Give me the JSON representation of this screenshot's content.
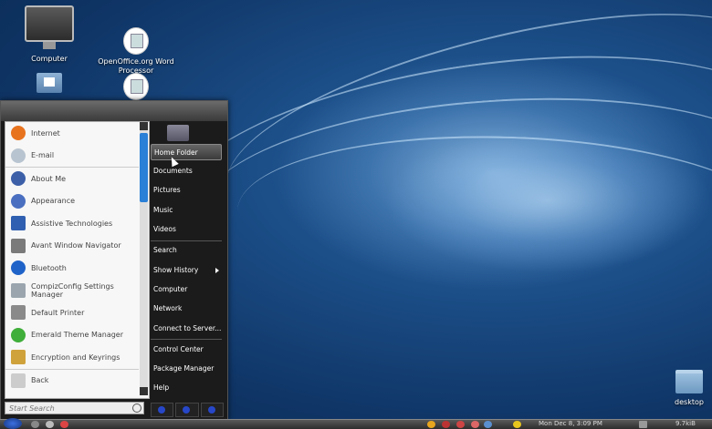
{
  "desktop": {
    "icons": [
      {
        "label": "Computer"
      },
      {
        "label": "OpenOffice.org Word Processor"
      },
      {
        "label": ""
      },
      {
        "label": ""
      },
      {
        "label": "desktop"
      }
    ]
  },
  "menu": {
    "apps": [
      {
        "label": "Internet",
        "color": "#e8731e"
      },
      {
        "label": "E-mail",
        "color": "#b8c4d0"
      },
      {
        "label": "About Me",
        "color": "#3c5fa8"
      },
      {
        "label": "Appearance",
        "color": "#4a6fc0"
      },
      {
        "label": "Assistive Technologies",
        "color": "#2f5fb0"
      },
      {
        "label": "Avant Window Navigator",
        "color": "#7a7a7a"
      },
      {
        "label": "Bluetooth",
        "color": "#1f63c9"
      },
      {
        "label": "CompizConfig Settings Manager",
        "color": "#9aa5ae"
      },
      {
        "label": "Default Printer",
        "color": "#8a8a8a"
      },
      {
        "label": "Emerald Theme Manager",
        "color": "#3fae3a"
      },
      {
        "label": "Encryption and Keyrings",
        "color": "#d0a23c"
      }
    ],
    "back_label": "Back",
    "search_placeholder": "Start Search",
    "places": [
      {
        "label": "Home Folder"
      },
      {
        "label": "Documents"
      },
      {
        "label": "Pictures"
      },
      {
        "label": "Music"
      },
      {
        "label": "Videos"
      },
      {
        "label": "Search"
      },
      {
        "label": "Show History"
      },
      {
        "label": "Computer"
      },
      {
        "label": "Network"
      },
      {
        "label": "Connect to Server..."
      },
      {
        "label": "Control Center"
      },
      {
        "label": "Package Manager"
      },
      {
        "label": "Help"
      }
    ]
  },
  "taskbar": {
    "clock": "Mon Dec 8, 3:09 PM",
    "tray_text": "9.7kiB"
  }
}
